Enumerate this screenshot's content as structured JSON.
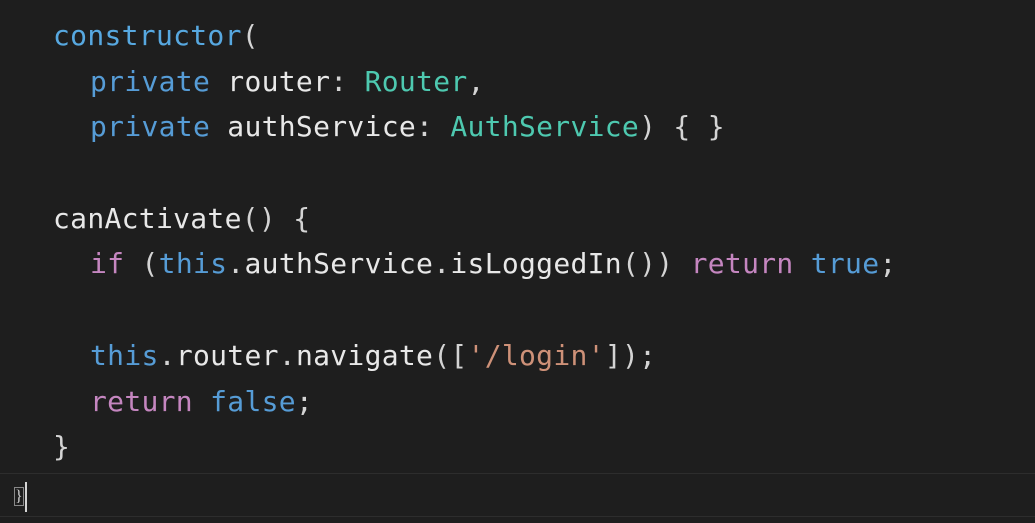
{
  "editor": {
    "background": "#1e1e1e",
    "lines": [
      {
        "indent": 0,
        "tokens": [
          {
            "t": "fn",
            "v": "constructor"
          },
          {
            "t": "pun",
            "v": "("
          }
        ]
      },
      {
        "indent": 1,
        "tokens": [
          {
            "t": "kwb",
            "v": "private"
          },
          {
            "t": "pun",
            "v": " "
          },
          {
            "t": "id",
            "v": "router"
          },
          {
            "t": "pun",
            "v": ": "
          },
          {
            "t": "type",
            "v": "Router"
          },
          {
            "t": "pun",
            "v": ","
          }
        ]
      },
      {
        "indent": 1,
        "tokens": [
          {
            "t": "kwb",
            "v": "private"
          },
          {
            "t": "pun",
            "v": " "
          },
          {
            "t": "id",
            "v": "authService"
          },
          {
            "t": "pun",
            "v": ": "
          },
          {
            "t": "type",
            "v": "AuthService"
          },
          {
            "t": "pun",
            "v": ") { }"
          }
        ]
      },
      {
        "indent": 0,
        "tokens": []
      },
      {
        "indent": 0,
        "tokens": [
          {
            "t": "id",
            "v": "canActivate"
          },
          {
            "t": "pun",
            "v": "() {"
          }
        ]
      },
      {
        "indent": 1,
        "tokens": [
          {
            "t": "kw",
            "v": "if"
          },
          {
            "t": "pun",
            "v": " ("
          },
          {
            "t": "kwb",
            "v": "this"
          },
          {
            "t": "pun",
            "v": "."
          },
          {
            "t": "id",
            "v": "authService"
          },
          {
            "t": "pun",
            "v": "."
          },
          {
            "t": "id",
            "v": "isLoggedIn"
          },
          {
            "t": "pun",
            "v": "()) "
          },
          {
            "t": "kw",
            "v": "return"
          },
          {
            "t": "pun",
            "v": " "
          },
          {
            "t": "kwb",
            "v": "true"
          },
          {
            "t": "pun",
            "v": ";"
          }
        ]
      },
      {
        "indent": 0,
        "tokens": []
      },
      {
        "indent": 1,
        "tokens": [
          {
            "t": "kwb",
            "v": "this"
          },
          {
            "t": "pun",
            "v": "."
          },
          {
            "t": "id",
            "v": "router"
          },
          {
            "t": "pun",
            "v": "."
          },
          {
            "t": "id",
            "v": "navigate"
          },
          {
            "t": "pun",
            "v": "(["
          },
          {
            "t": "str",
            "v": "'/login'"
          },
          {
            "t": "pun",
            "v": "]);"
          }
        ]
      },
      {
        "indent": 1,
        "tokens": [
          {
            "t": "kw",
            "v": "return"
          },
          {
            "t": "pun",
            "v": " "
          },
          {
            "t": "kwb",
            "v": "false"
          },
          {
            "t": "pun",
            "v": ";"
          }
        ]
      },
      {
        "indent": 0,
        "tokens": [
          {
            "t": "pun",
            "v": "}"
          }
        ]
      }
    ],
    "last_line": {
      "text": "}"
    }
  }
}
